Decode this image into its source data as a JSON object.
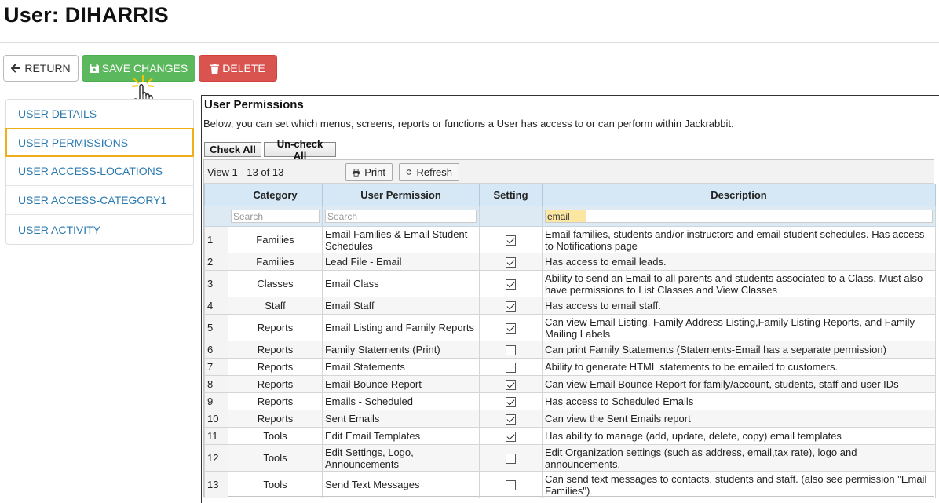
{
  "page": {
    "title": "User: DIHARRIS"
  },
  "toolbar": {
    "return_label": "RETURN",
    "save_label": "SAVE CHANGES",
    "delete_label": "DELETE"
  },
  "sidebar": {
    "items": [
      {
        "label": "USER DETAILS",
        "active": false
      },
      {
        "label": "USER PERMISSIONS",
        "active": true
      },
      {
        "label": "USER ACCESS-LOCATIONS",
        "active": false
      },
      {
        "label": "USER ACCESS-CATEGORY1",
        "active": false
      },
      {
        "label": "USER ACTIVITY",
        "active": false
      }
    ]
  },
  "panel": {
    "title": "User Permissions",
    "description": "Below, you can set which menus, screens, reports or functions a User has access to or can perform within Jackrabbit.",
    "check_all_label": "Check All",
    "uncheck_all_label": "Un-check All"
  },
  "grid": {
    "view_text": "View 1 - 13 of 13",
    "print_label": "Print",
    "refresh_label": "Refresh",
    "columns": {
      "category": "Category",
      "permission": "User Permission",
      "setting": "Setting",
      "description": "Description"
    },
    "filters": {
      "category_placeholder": "Search",
      "permission_placeholder": "Search",
      "description_value": "email"
    },
    "rows": [
      {
        "num": "1",
        "category": "Families",
        "permission": "Email Families & Email Student Schedules",
        "checked": true,
        "description": "Email families, students and/or instructors and email student schedules. Has access to Notifications page"
      },
      {
        "num": "2",
        "category": "Families",
        "permission": "Lead File - Email",
        "checked": true,
        "description": "Has access to email leads."
      },
      {
        "num": "3",
        "category": "Classes",
        "permission": "Email Class",
        "checked": true,
        "description": "Ability to send an Email to all parents and students associated to a Class. Must also have permissions to List Classes and View Classes"
      },
      {
        "num": "4",
        "category": "Staff",
        "permission": "Email Staff",
        "checked": true,
        "description": "Has access to email staff."
      },
      {
        "num": "5",
        "category": "Reports",
        "permission": "Email Listing and Family Reports",
        "checked": true,
        "description": "Can view Email Listing, Family Address Listing,Family Listing Reports, and Family Mailing Labels"
      },
      {
        "num": "6",
        "category": "Reports",
        "permission": "Family Statements (Print)",
        "checked": false,
        "description": "Can print Family Statements (Statements-Email has a separate permission)"
      },
      {
        "num": "7",
        "category": "Reports",
        "permission": "Email Statements",
        "checked": false,
        "description": "Ability to generate HTML statements to be emailed to customers."
      },
      {
        "num": "8",
        "category": "Reports",
        "permission": "Email Bounce Report",
        "checked": true,
        "description": "Can view Email Bounce Report for family/account, students, staff and user IDs"
      },
      {
        "num": "9",
        "category": "Reports",
        "permission": "Emails - Scheduled",
        "checked": true,
        "description": "Has access to Scheduled Emails"
      },
      {
        "num": "10",
        "category": "Reports",
        "permission": "Sent Emails",
        "checked": true,
        "description": "Can view the Sent Emails report"
      },
      {
        "num": "11",
        "category": "Tools",
        "permission": "Edit Email Templates",
        "checked": true,
        "description": "Has ability to manage (add, update, delete, copy) email templates"
      },
      {
        "num": "12",
        "category": "Tools",
        "permission": "Edit Settings, Logo, Announcements",
        "checked": false,
        "description": "Edit Organization settings (such as address, email,tax rate), logo and announcements."
      },
      {
        "num": "13",
        "category": "Tools",
        "permission": "Send Text Messages",
        "checked": false,
        "description": "Can send text messages to contacts, students and staff. (also see permission \"Email Families\")"
      }
    ]
  },
  "colors": {
    "save": "#5cb85c",
    "delete": "#d9534f",
    "link": "#2a7ab0",
    "active_outline": "#f0ad1c",
    "header": "#d6e8f5"
  }
}
